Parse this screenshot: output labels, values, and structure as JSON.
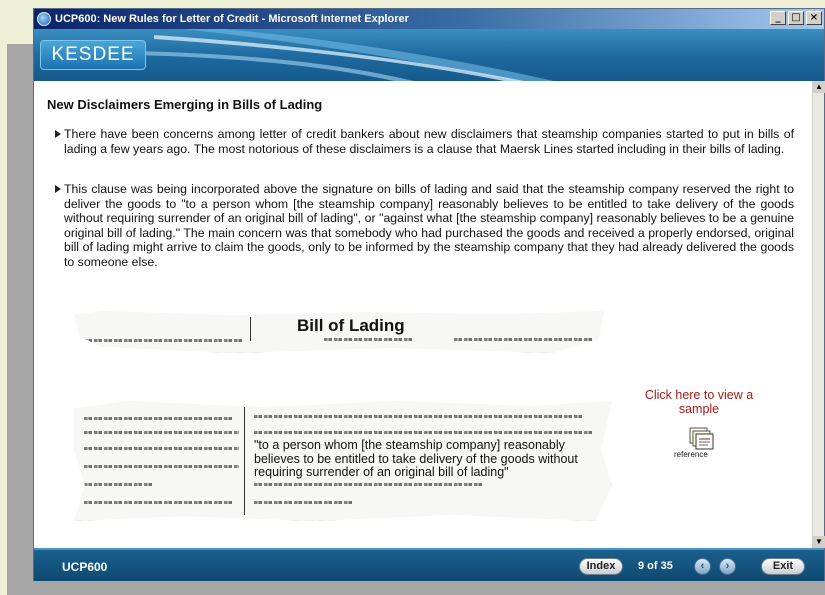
{
  "window": {
    "title": "UCP600: New Rules for Letter of Credit - Microsoft Internet Explorer",
    "buttons": [
      "_",
      "□",
      "×"
    ]
  },
  "header": {
    "logo": "KESDEE"
  },
  "content": {
    "heading": "New Disclaimers Emerging in Bills of Lading",
    "bullets": [
      "There have been concerns among letter of credit bankers about new disclaimers that steamship companies started to put in bills of lading a few years ago. The most notorious of these disclaimers is a clause that Maersk Lines started including in their bills of lading.",
      "This clause was being incorporated above the signature on bills of lading and said that the steamship company reserved the right to deliver the goods to \"to a person whom [the steamship company] reasonably believes to be entitled to take delivery of the goods without requiring surrender of an original bill of lading\", or \"against what [the steamship company] reasonably believes to be a genuine original bill of lading.\" The main concern was that somebody who had purchased the goods and received a properly endorsed, original bill of lading might arrive to claim the goods, only to be informed by the steamship company that they had already delivered the goods to someone else."
    ],
    "document_title": "Bill of Lading",
    "quote": "\"to a person whom [the steamship company] reasonably believes to be entitled to take delivery of the goods without requiring surrender of an original bill of lading\"",
    "reference_link": "Click here to view a sample",
    "reference_icon": "document-stack-icon",
    "reference_label": "reference"
  },
  "footer": {
    "course": "UCP600",
    "index_label": "Index",
    "page_indicator": "9 of 35",
    "exit_label": "Exit",
    "prev_icon": "back-arrow-icon",
    "next_icon": "forward-arrow-icon"
  },
  "colors": {
    "header_blue": "#1f6aa0",
    "footer_blue": "#0e4a72",
    "link_red": "#a31b14"
  }
}
